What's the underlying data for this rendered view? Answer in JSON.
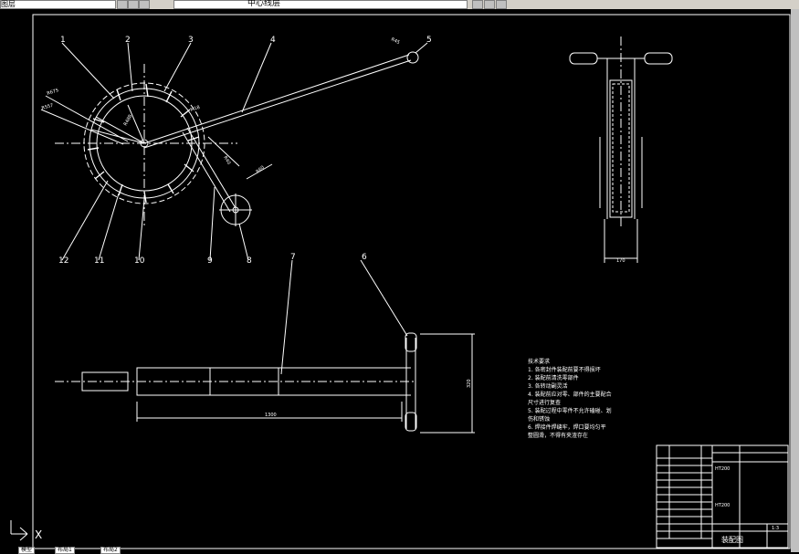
{
  "toolbar": {
    "layer_field": "图层",
    "linetype_label": "中心线层"
  },
  "leaders": {
    "l1": "1",
    "l2": "2",
    "l3": "3",
    "l4": "4",
    "l5": "5",
    "l6": "6",
    "l7": "7",
    "l8": "8",
    "l9": "9",
    "l10": "10",
    "l11": "11",
    "l12": "12"
  },
  "dims": {
    "d_side_width": "170",
    "d_len": "1300",
    "d_height": "320",
    "d_r1": "R675",
    "d_r2": "R557",
    "d_r3": "R488",
    "d_r4": "R45",
    "d_r5": "R60",
    "d_r6": "R40",
    "d_r7": "M18"
  },
  "notes": {
    "title": "技术要求",
    "n1": "1. 各密封件装配前要不得损坏",
    "n2": "2. 装配前清洗零部件",
    "n3": "3. 各转动副灵活",
    "n4": "4. 装配前应对零、部件的主要配合",
    "n4b": "尺寸进行复查",
    "n5": "5. 装配过程中零件不允许磕碰、划",
    "n5b": "伤和锈蚀",
    "n6": "6. 焊接件焊缝牢，焊口要均匀平",
    "n6b": "整圆滑，不得有夹渣存在"
  },
  "title_block": {
    "drawing_name": "装配图",
    "material1": "HT200",
    "material2": "HT200",
    "scale": "1:3"
  },
  "ucs": {
    "x": "X"
  },
  "tabs": {
    "model": "模型",
    "layout1": "布局1",
    "layout2": "布局2"
  }
}
